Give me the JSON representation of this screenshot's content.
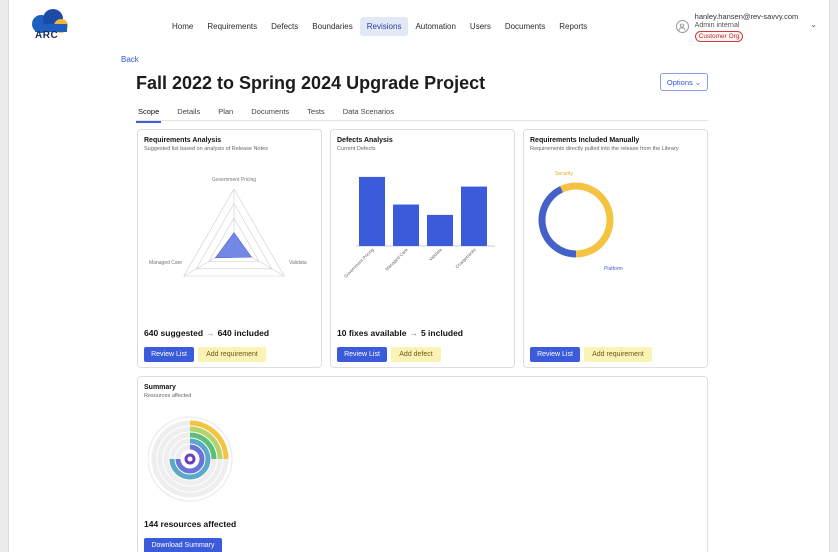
{
  "app": {
    "logo_text": "ARC"
  },
  "nav": {
    "items": [
      {
        "label": "Home"
      },
      {
        "label": "Requirements"
      },
      {
        "label": "Defects"
      },
      {
        "label": "Boundaries"
      },
      {
        "label": "Revisions",
        "active": true
      },
      {
        "label": "Automation"
      },
      {
        "label": "Users"
      },
      {
        "label": "Documents"
      },
      {
        "label": "Reports"
      }
    ]
  },
  "user": {
    "email": "hanley.hansen@rev-savvy.com",
    "role": "Admin internal",
    "org_badge": "Customer Org"
  },
  "page": {
    "back_label": "Back",
    "title": "Fall 2022 to Spring 2024 Upgrade Project",
    "options_label": "Options"
  },
  "tabs": [
    {
      "label": "Scope",
      "active": true
    },
    {
      "label": "Details"
    },
    {
      "label": "Plan"
    },
    {
      "label": "Documents"
    },
    {
      "label": "Tests"
    },
    {
      "label": "Data Scenarios"
    }
  ],
  "cards": {
    "requirements_analysis": {
      "title": "Requirements Analysis",
      "subtitle": "Suggested list based on analysis of Release Notes",
      "stat_left": "640 suggested",
      "stat_right": "640 included",
      "primary_label": "Review List",
      "secondary_label": "Add requirement",
      "radar_labels": {
        "top": "Government Pricing",
        "left": "Managed Care",
        "right": "Validata"
      }
    },
    "defects_analysis": {
      "title": "Defects Analysis",
      "subtitle": "Current Defects",
      "stat_left": "10 fixes available",
      "stat_right": "5 included",
      "primary_label": "Review List",
      "secondary_label": "Add defect"
    },
    "requirements_manual": {
      "title": "Requirements Included Manually",
      "subtitle": "Requirements directly pulled into the release from the Library",
      "primary_label": "Review List",
      "secondary_label": "Add requirement",
      "donut_labels": {
        "security": "Security",
        "platform": "Platform"
      }
    },
    "summary": {
      "title": "Summary",
      "subtitle": "Resources affected",
      "stat": "144 resources affected",
      "primary_label": "Download Summary"
    }
  },
  "chart_data": [
    {
      "type": "radar",
      "axes": [
        "Government Pricing",
        "Validata",
        "Managed Care"
      ],
      "series": [
        {
          "values": [
            1.0,
            1.4,
            1.5
          ]
        }
      ],
      "rmax": 4,
      "grid": true
    },
    {
      "type": "bar",
      "categories": [
        "Government Pricing",
        "Managed Care",
        "Validata",
        "Chargebacks"
      ],
      "values": [
        10,
        6,
        4.5,
        8.6
      ],
      "ylim": [
        0,
        11
      ],
      "color": "#3b5bdb"
    },
    {
      "type": "pie",
      "donut": true,
      "categories": [
        "Platform",
        "Security"
      ],
      "values": [
        43,
        57
      ],
      "colors": [
        "#4361c9",
        "#f5c342"
      ]
    }
  ],
  "colors": {
    "primary": "#3b5bdb",
    "secondary": "#fbf3b5",
    "accent": "#f5c342"
  }
}
